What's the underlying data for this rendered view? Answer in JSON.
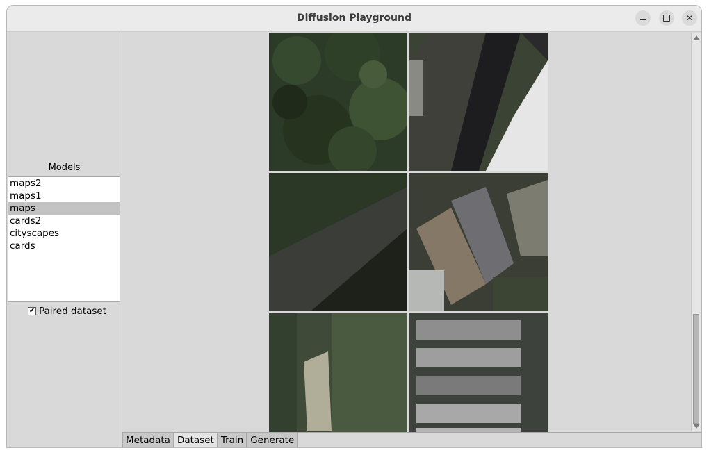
{
  "window": {
    "title": "Diffusion Playground"
  },
  "sidebar": {
    "models_label": "Models",
    "models": [
      {
        "label": "maps2",
        "selected": false
      },
      {
        "label": "maps1",
        "selected": false
      },
      {
        "label": "maps",
        "selected": true
      },
      {
        "label": "cards2",
        "selected": false
      },
      {
        "label": "cityscapes",
        "selected": false
      },
      {
        "label": "cards",
        "selected": false
      }
    ],
    "paired_dataset": {
      "label": "Paired dataset",
      "checked": true
    }
  },
  "tabs": [
    {
      "label": "Metadata",
      "active": false
    },
    {
      "label": "Dataset",
      "active": true
    },
    {
      "label": "Train",
      "active": false
    },
    {
      "label": "Generate",
      "active": false
    }
  ],
  "dataset_tiles": [
    {
      "name": "dense-trees",
      "base": "#2c3a28"
    },
    {
      "name": "road-with-roof",
      "base": "#353a33"
    },
    {
      "name": "diagonal-road",
      "base": "#2d3229"
    },
    {
      "name": "rooftops",
      "base": "#5e5c55"
    },
    {
      "name": "vegetation-field",
      "base": "#3f4a38"
    },
    {
      "name": "parked-cars",
      "base": "#4a4d48"
    }
  ],
  "colors": {
    "window_bg": "#d9d9d9",
    "selection": "#c3c3c3"
  }
}
